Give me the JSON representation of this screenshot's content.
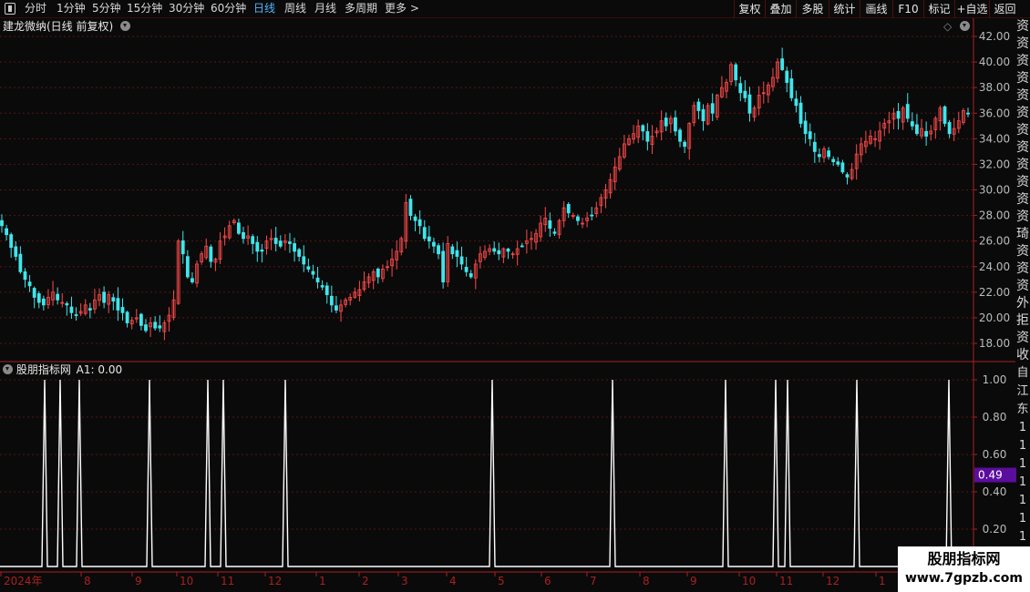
{
  "toolbar": {
    "periods": [
      "分时",
      "1分钟",
      "5分钟",
      "15分钟",
      "30分钟",
      "60分钟",
      "日线",
      "周线",
      "月线",
      "多周期",
      "更多 >"
    ],
    "active_period": "日线",
    "right_buttons": [
      "复权",
      "叠加",
      "多股",
      "统计",
      "画线",
      "F10",
      "标记",
      "+自选",
      "返回"
    ]
  },
  "main_panel": {
    "title": "建龙微纳(日线 前复权)",
    "price_ticks": [
      "42.00",
      "40.00",
      "38.00",
      "36.00",
      "34.00",
      "32.00",
      "30.00",
      "28.00",
      "26.00",
      "24.00",
      "22.00",
      "20.00",
      "18.00"
    ]
  },
  "indicator_panel": {
    "name": "股朋指标网",
    "a1_label": "A1: 0.00",
    "ticks": [
      "1.00",
      "0.80",
      "0.60",
      "0.40",
      "0.20"
    ],
    "current_value": "0.49"
  },
  "date_axis": {
    "labels": [
      "2024年",
      "8",
      "9",
      "10",
      "11",
      "12",
      "1",
      "2",
      "3",
      "4",
      "5",
      "6",
      "7",
      "8",
      "9",
      "10",
      "11",
      "12",
      "1"
    ]
  },
  "watermark": {
    "line1": "股朋指标网",
    "line2": "www.7gpzb.com"
  },
  "side_strip": [
    "资",
    "资",
    "资",
    "资",
    "资",
    "资",
    "资",
    "资",
    "资",
    "资",
    "资",
    "资",
    "琦",
    "资",
    "资",
    "资",
    "外",
    "拒",
    "资",
    "收"
  ],
  "side_strip2": [
    "自",
    "江",
    "东",
    "1",
    "1",
    "1",
    "1",
    "1",
    "1",
    "1"
  ],
  "colors": {
    "up": "#ff4a4a",
    "down": "#3fe6ec",
    "grid": "#5a1414",
    "axis": "#aa2020",
    "indicator": "#ffffff",
    "badge": "#5b0d9e"
  },
  "chart_data": [
    {
      "type": "candlestick",
      "title": "建龙微纳(日线 前复权)",
      "ylim": [
        17,
        43
      ],
      "close_path": [
        [
          0,
          27.2
        ],
        [
          4,
          26.5
        ],
        [
          8,
          25.5
        ],
        [
          12,
          24.8
        ],
        [
          16,
          23.6
        ],
        [
          20,
          23.0
        ],
        [
          24,
          22.5
        ],
        [
          28,
          21.6
        ],
        [
          32,
          21.2
        ],
        [
          36,
          21.0
        ],
        [
          40,
          21.6
        ],
        [
          44,
          22.0
        ],
        [
          48,
          21.4
        ],
        [
          52,
          21.2
        ],
        [
          56,
          21.0
        ],
        [
          60,
          20.4
        ],
        [
          64,
          20.2
        ],
        [
          68,
          20.5
        ],
        [
          72,
          21.0
        ],
        [
          76,
          20.6
        ],
        [
          80,
          21.4
        ],
        [
          84,
          21.8
        ],
        [
          88,
          21.2
        ],
        [
          92,
          21.8
        ],
        [
          96,
          21.3
        ],
        [
          100,
          20.6
        ],
        [
          104,
          20.4
        ],
        [
          108,
          19.6
        ],
        [
          112,
          19.8
        ],
        [
          116,
          20.0
        ],
        [
          120,
          19.4
        ],
        [
          124,
          19.0
        ],
        [
          128,
          19.6
        ],
        [
          132,
          19.2
        ],
        [
          136,
          19.2
        ],
        [
          140,
          19.6
        ],
        [
          144,
          20.2
        ],
        [
          148,
          21.4
        ],
        [
          152,
          26.0
        ],
        [
          156,
          25.0
        ],
        [
          160,
          23.2
        ],
        [
          164,
          22.8
        ],
        [
          168,
          24.2
        ],
        [
          172,
          25.0
        ],
        [
          176,
          25.6
        ],
        [
          180,
          24.4
        ],
        [
          184,
          24.6
        ],
        [
          188,
          26.0
        ],
        [
          192,
          26.4
        ],
        [
          196,
          27.2
        ],
        [
          200,
          27.6
        ],
        [
          204,
          26.6
        ],
        [
          208,
          26.2
        ],
        [
          212,
          26.4
        ],
        [
          216,
          25.8
        ],
        [
          220,
          25.2
        ],
        [
          224,
          25.2
        ],
        [
          228,
          26.0
        ],
        [
          232,
          26.2
        ],
        [
          236,
          25.8
        ],
        [
          240,
          25.6
        ],
        [
          244,
          26.0
        ],
        [
          248,
          25.8
        ],
        [
          252,
          25.2
        ],
        [
          256,
          24.8
        ],
        [
          260,
          24.2
        ],
        [
          264,
          23.8
        ],
        [
          268,
          23.4
        ],
        [
          272,
          22.8
        ],
        [
          276,
          22.4
        ],
        [
          280,
          21.8
        ],
        [
          284,
          21.0
        ],
        [
          288,
          20.6
        ],
        [
          292,
          21.0
        ],
        [
          296,
          21.4
        ],
        [
          300,
          21.6
        ],
        [
          304,
          22.0
        ],
        [
          308,
          22.2
        ],
        [
          312,
          22.8
        ],
        [
          316,
          23.2
        ],
        [
          320,
          23.6
        ],
        [
          324,
          23.2
        ],
        [
          328,
          23.8
        ],
        [
          332,
          24.0
        ],
        [
          336,
          24.6
        ],
        [
          340,
          25.2
        ],
        [
          344,
          26.2
        ],
        [
          348,
          29.0
        ],
        [
          352,
          28.0
        ],
        [
          356,
          27.6
        ],
        [
          360,
          27.2
        ],
        [
          364,
          26.2
        ],
        [
          368,
          26.0
        ],
        [
          372,
          25.6
        ],
        [
          376,
          25.0
        ],
        [
          380,
          22.8
        ],
        [
          384,
          25.8
        ],
        [
          388,
          25.0
        ],
        [
          392,
          24.8
        ],
        [
          396,
          24.2
        ],
        [
          400,
          23.6
        ],
        [
          404,
          23.2
        ],
        [
          408,
          24.2
        ],
        [
          412,
          25.0
        ],
        [
          416,
          25.2
        ],
        [
          420,
          25.4
        ],
        [
          424,
          25.2
        ],
        [
          428,
          25.0
        ],
        [
          432,
          25.4
        ],
        [
          436,
          25.2
        ],
        [
          440,
          25.0
        ],
        [
          444,
          25.4
        ],
        [
          448,
          25.6
        ],
        [
          452,
          26.0
        ],
        [
          456,
          26.2
        ],
        [
          460,
          26.6
        ],
        [
          464,
          27.4
        ],
        [
          468,
          27.8
        ],
        [
          472,
          27.0
        ],
        [
          476,
          26.6
        ],
        [
          480,
          27.6
        ],
        [
          484,
          28.6
        ],
        [
          488,
          28.2
        ],
        [
          492,
          28.0
        ],
        [
          496,
          27.6
        ],
        [
          500,
          27.4
        ],
        [
          504,
          27.8
        ],
        [
          508,
          28.0
        ],
        [
          512,
          28.6
        ],
        [
          516,
          29.4
        ],
        [
          520,
          30.0
        ],
        [
          524,
          30.8
        ],
        [
          528,
          31.8
        ],
        [
          532,
          32.6
        ],
        [
          536,
          33.6
        ],
        [
          540,
          34.0
        ],
        [
          544,
          34.4
        ],
        [
          548,
          35.0
        ],
        [
          552,
          34.6
        ],
        [
          556,
          33.8
        ],
        [
          560,
          34.2
        ],
        [
          564,
          34.6
        ],
        [
          568,
          35.4
        ],
        [
          572,
          35.0
        ],
        [
          576,
          35.6
        ],
        [
          580,
          34.6
        ],
        [
          584,
          33.8
        ],
        [
          588,
          33.4
        ],
        [
          592,
          35.2
        ],
        [
          596,
          36.6
        ],
        [
          600,
          36.2
        ],
        [
          604,
          35.4
        ],
        [
          608,
          36.6
        ],
        [
          612,
          36.0
        ],
        [
          616,
          37.4
        ],
        [
          620,
          38.0
        ],
        [
          624,
          38.4
        ],
        [
          628,
          39.8
        ],
        [
          632,
          38.6
        ],
        [
          636,
          37.6
        ],
        [
          640,
          37.2
        ],
        [
          644,
          36.0
        ],
        [
          648,
          36.4
        ],
        [
          652,
          37.4
        ],
        [
          656,
          37.6
        ],
        [
          660,
          38.2
        ],
        [
          664,
          38.8
        ],
        [
          668,
          40.0
        ],
        [
          672,
          39.4
        ],
        [
          676,
          38.4
        ],
        [
          680,
          37.2
        ],
        [
          684,
          36.6
        ],
        [
          688,
          35.2
        ],
        [
          692,
          34.4
        ],
        [
          696,
          34.0
        ],
        [
          700,
          33.0
        ],
        [
          704,
          32.6
        ],
        [
          708,
          33.2
        ],
        [
          712,
          32.6
        ],
        [
          716,
          32.2
        ],
        [
          720,
          32.0
        ],
        [
          724,
          31.4
        ],
        [
          728,
          31.0
        ],
        [
          732,
          31.6
        ],
        [
          736,
          32.8
        ],
        [
          740,
          33.6
        ],
        [
          744,
          33.8
        ],
        [
          748,
          34.2
        ],
        [
          752,
          34.0
        ],
        [
          756,
          34.6
        ],
        [
          760,
          35.2
        ],
        [
          764,
          35.4
        ],
        [
          768,
          36.0
        ],
        [
          772,
          35.6
        ],
        [
          776,
          36.4
        ],
        [
          780,
          35.6
        ],
        [
          784,
          35.0
        ],
        [
          788,
          34.4
        ],
        [
          792,
          34.8
        ],
        [
          796,
          34.2
        ],
        [
          800,
          34.6
        ],
        [
          804,
          35.6
        ],
        [
          808,
          36.4
        ],
        [
          812,
          35.2
        ],
        [
          816,
          34.4
        ],
        [
          820,
          34.8
        ],
        [
          824,
          35.4
        ],
        [
          828,
          36.2
        ],
        [
          832,
          36.0
        ]
      ]
    },
    {
      "type": "line",
      "title": "股朋指标网",
      "ylim": [
        0,
        1.05
      ],
      "x": [
        "2024年",
        "8",
        "9",
        "10",
        "11",
        "12",
        "1",
        "2",
        "3",
        "4",
        "5",
        "6",
        "7",
        "8",
        "9",
        "10",
        "11",
        "12",
        "1"
      ],
      "series": [
        {
          "name": "A1",
          "spikes": 16,
          "baseline": 0,
          "peak": 1.0
        }
      ]
    }
  ]
}
